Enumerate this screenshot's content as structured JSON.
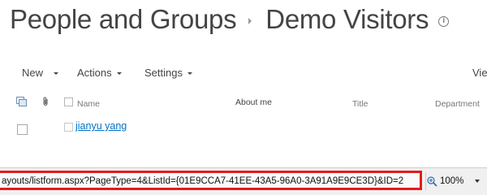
{
  "header": {
    "breadcrumb_parent": "People and Groups",
    "page_title": "Demo Visitors",
    "info_icon": "info-icon"
  },
  "toolbar": {
    "new_label": "New",
    "actions_label": "Actions",
    "settings_label": "Settings",
    "view_label": "Vie"
  },
  "columns": {
    "name": "Name",
    "about_me": "About me",
    "title": "Title",
    "department": "Department"
  },
  "rows": [
    {
      "name": "jianyu yang"
    }
  ],
  "statusbar": {
    "url": "ayouts/listform.aspx?PageType=4&ListId={01E9CCA7-41EE-43A5-96A0-3A91A9E9CE3D}&ID=2",
    "zoom": "100%"
  },
  "colors": {
    "link": "#0072c6",
    "highlight_border": "#e31b1b",
    "title_text": "#444444"
  }
}
